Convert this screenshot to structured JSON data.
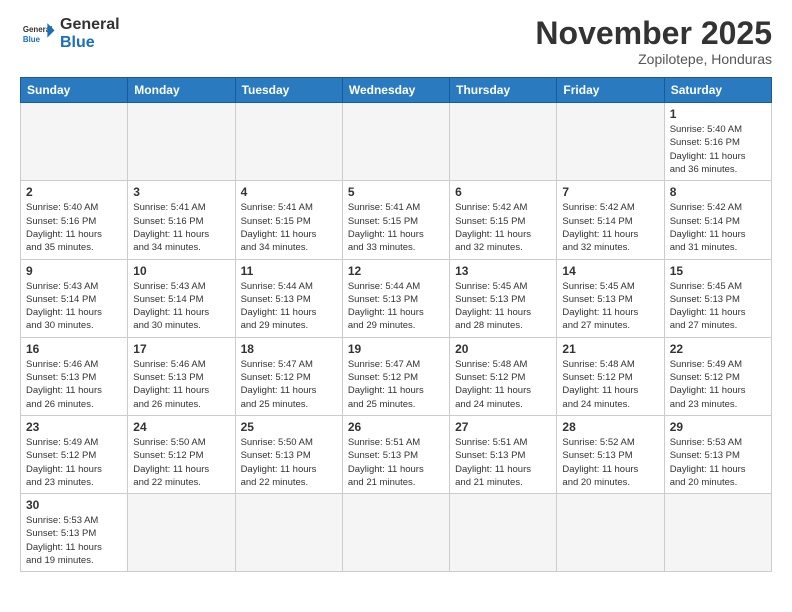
{
  "header": {
    "logo_general": "General",
    "logo_blue": "Blue",
    "month_title": "November 2025",
    "location": "Zopilotepe, Honduras"
  },
  "weekdays": [
    "Sunday",
    "Monday",
    "Tuesday",
    "Wednesday",
    "Thursday",
    "Friday",
    "Saturday"
  ],
  "days": [
    {
      "date": "",
      "info": ""
    },
    {
      "date": "",
      "info": ""
    },
    {
      "date": "",
      "info": ""
    },
    {
      "date": "",
      "info": ""
    },
    {
      "date": "",
      "info": ""
    },
    {
      "date": "",
      "info": ""
    },
    {
      "date": "1",
      "info": "Sunrise: 5:40 AM\nSunset: 5:16 PM\nDaylight: 11 hours\nand 36 minutes."
    },
    {
      "date": "2",
      "info": "Sunrise: 5:40 AM\nSunset: 5:16 PM\nDaylight: 11 hours\nand 35 minutes."
    },
    {
      "date": "3",
      "info": "Sunrise: 5:41 AM\nSunset: 5:16 PM\nDaylight: 11 hours\nand 34 minutes."
    },
    {
      "date": "4",
      "info": "Sunrise: 5:41 AM\nSunset: 5:15 PM\nDaylight: 11 hours\nand 34 minutes."
    },
    {
      "date": "5",
      "info": "Sunrise: 5:41 AM\nSunset: 5:15 PM\nDaylight: 11 hours\nand 33 minutes."
    },
    {
      "date": "6",
      "info": "Sunrise: 5:42 AM\nSunset: 5:15 PM\nDaylight: 11 hours\nand 32 minutes."
    },
    {
      "date": "7",
      "info": "Sunrise: 5:42 AM\nSunset: 5:14 PM\nDaylight: 11 hours\nand 32 minutes."
    },
    {
      "date": "8",
      "info": "Sunrise: 5:42 AM\nSunset: 5:14 PM\nDaylight: 11 hours\nand 31 minutes."
    },
    {
      "date": "9",
      "info": "Sunrise: 5:43 AM\nSunset: 5:14 PM\nDaylight: 11 hours\nand 30 minutes."
    },
    {
      "date": "10",
      "info": "Sunrise: 5:43 AM\nSunset: 5:14 PM\nDaylight: 11 hours\nand 30 minutes."
    },
    {
      "date": "11",
      "info": "Sunrise: 5:44 AM\nSunset: 5:13 PM\nDaylight: 11 hours\nand 29 minutes."
    },
    {
      "date": "12",
      "info": "Sunrise: 5:44 AM\nSunset: 5:13 PM\nDaylight: 11 hours\nand 29 minutes."
    },
    {
      "date": "13",
      "info": "Sunrise: 5:45 AM\nSunset: 5:13 PM\nDaylight: 11 hours\nand 28 minutes."
    },
    {
      "date": "14",
      "info": "Sunrise: 5:45 AM\nSunset: 5:13 PM\nDaylight: 11 hours\nand 27 minutes."
    },
    {
      "date": "15",
      "info": "Sunrise: 5:45 AM\nSunset: 5:13 PM\nDaylight: 11 hours\nand 27 minutes."
    },
    {
      "date": "16",
      "info": "Sunrise: 5:46 AM\nSunset: 5:13 PM\nDaylight: 11 hours\nand 26 minutes."
    },
    {
      "date": "17",
      "info": "Sunrise: 5:46 AM\nSunset: 5:13 PM\nDaylight: 11 hours\nand 26 minutes."
    },
    {
      "date": "18",
      "info": "Sunrise: 5:47 AM\nSunset: 5:12 PM\nDaylight: 11 hours\nand 25 minutes."
    },
    {
      "date": "19",
      "info": "Sunrise: 5:47 AM\nSunset: 5:12 PM\nDaylight: 11 hours\nand 25 minutes."
    },
    {
      "date": "20",
      "info": "Sunrise: 5:48 AM\nSunset: 5:12 PM\nDaylight: 11 hours\nand 24 minutes."
    },
    {
      "date": "21",
      "info": "Sunrise: 5:48 AM\nSunset: 5:12 PM\nDaylight: 11 hours\nand 24 minutes."
    },
    {
      "date": "22",
      "info": "Sunrise: 5:49 AM\nSunset: 5:12 PM\nDaylight: 11 hours\nand 23 minutes."
    },
    {
      "date": "23",
      "info": "Sunrise: 5:49 AM\nSunset: 5:12 PM\nDaylight: 11 hours\nand 23 minutes."
    },
    {
      "date": "24",
      "info": "Sunrise: 5:50 AM\nSunset: 5:12 PM\nDaylight: 11 hours\nand 22 minutes."
    },
    {
      "date": "25",
      "info": "Sunrise: 5:50 AM\nSunset: 5:13 PM\nDaylight: 11 hours\nand 22 minutes."
    },
    {
      "date": "26",
      "info": "Sunrise: 5:51 AM\nSunset: 5:13 PM\nDaylight: 11 hours\nand 21 minutes."
    },
    {
      "date": "27",
      "info": "Sunrise: 5:51 AM\nSunset: 5:13 PM\nDaylight: 11 hours\nand 21 minutes."
    },
    {
      "date": "28",
      "info": "Sunrise: 5:52 AM\nSunset: 5:13 PM\nDaylight: 11 hours\nand 20 minutes."
    },
    {
      "date": "29",
      "info": "Sunrise: 5:53 AM\nSunset: 5:13 PM\nDaylight: 11 hours\nand 20 minutes."
    },
    {
      "date": "30",
      "info": "Sunrise: 5:53 AM\nSunset: 5:13 PM\nDaylight: 11 hours\nand 19 minutes."
    },
    {
      "date": "",
      "info": ""
    },
    {
      "date": "",
      "info": ""
    },
    {
      "date": "",
      "info": ""
    },
    {
      "date": "",
      "info": ""
    },
    {
      "date": "",
      "info": ""
    },
    {
      "date": "",
      "info": ""
    }
  ]
}
